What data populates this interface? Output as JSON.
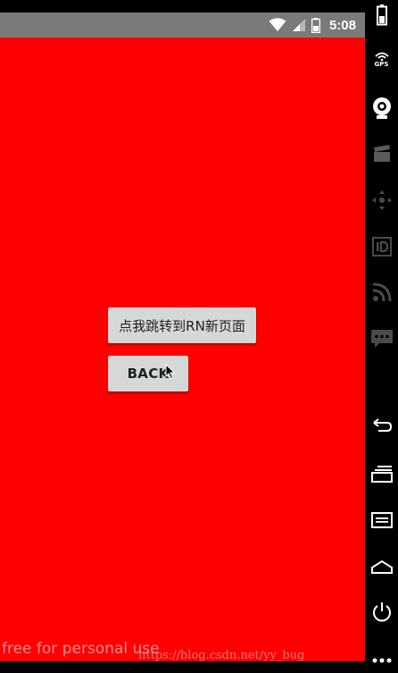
{
  "status_bar": {
    "time": "5:08",
    "background_color": "#7a7a7a",
    "icons": [
      "wifi-icon",
      "cell-signal-icon",
      "battery-icon"
    ]
  },
  "app": {
    "background_color": "#ff0000",
    "buttons": {
      "navigate_rn_label": "点我跳转到RN新页面",
      "back_label": "BACK"
    }
  },
  "emulator_toolbar": {
    "gps_label": "GPS",
    "icons": [
      "battery-icon",
      "gps-icon",
      "camera-icon",
      "clapper-icon",
      "dpad-icon",
      "id-icon",
      "rss-icon",
      "sms-icon",
      "back-icon",
      "recents-icon",
      "menu-icon",
      "home-icon",
      "power-icon",
      "more-icon"
    ]
  },
  "watermarks": {
    "left": "free for personal use",
    "right": "https://blog.csdn.net/yy_bug"
  }
}
